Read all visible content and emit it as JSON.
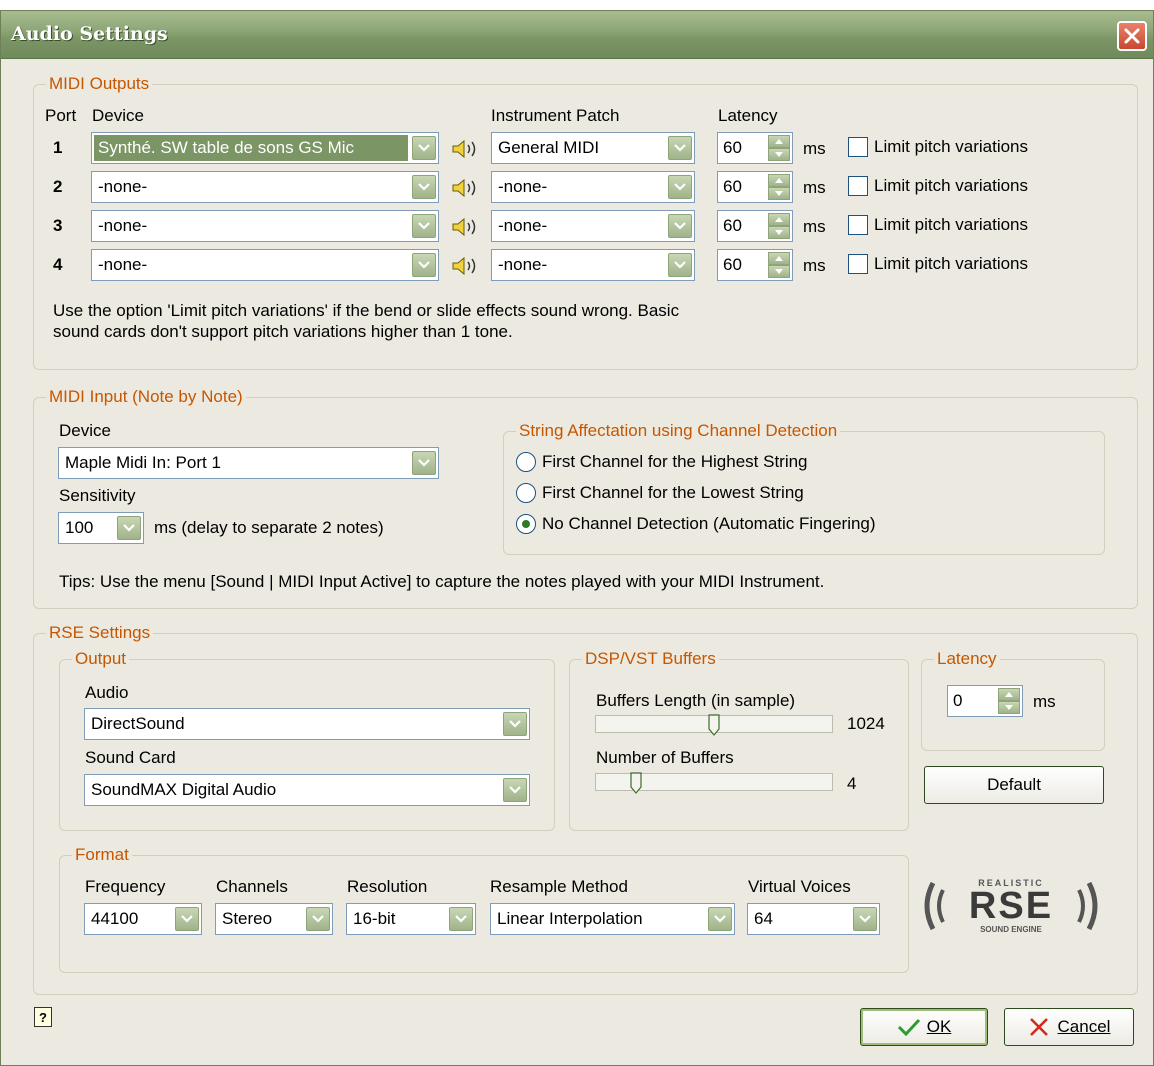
{
  "window": {
    "title": "Audio Settings"
  },
  "midi_outputs": {
    "legend": "MIDI Outputs",
    "headers": {
      "port": "Port",
      "device": "Device",
      "patch": "Instrument Patch",
      "latency": "Latency"
    },
    "rows": [
      {
        "port": "1",
        "device": "Synthé. SW table de sons GS Mic",
        "patch": "General MIDI",
        "latency": "60",
        "unit": "ms",
        "limit": "Limit pitch variations",
        "limit_checked": false
      },
      {
        "port": "2",
        "device": "-none-",
        "patch": "-none-",
        "latency": "60",
        "unit": "ms",
        "limit": "Limit pitch variations",
        "limit_checked": false
      },
      {
        "port": "3",
        "device": "-none-",
        "patch": "-none-",
        "latency": "60",
        "unit": "ms",
        "limit": "Limit pitch variations",
        "limit_checked": false
      },
      {
        "port": "4",
        "device": "-none-",
        "patch": "-none-",
        "latency": "60",
        "unit": "ms",
        "limit": "Limit pitch variations",
        "limit_checked": false
      }
    ],
    "note_line1": "Use the option 'Limit pitch variations' if the bend or slide effects sound wrong. Basic",
    "note_line2": "sound cards don't support pitch variations higher than 1 tone."
  },
  "midi_input": {
    "legend": "MIDI Input (Note by Note)",
    "device_label": "Device",
    "device": "Maple Midi In: Port 1",
    "sensitivity_label": "Sensitivity",
    "sensitivity": "100",
    "sensitivity_note": "ms  (delay to separate 2 notes)",
    "string_group": {
      "legend": "String Affectation using Channel Detection",
      "options": [
        {
          "label": "First Channel for the Highest String",
          "selected": false
        },
        {
          "label": "First Channel for the Lowest String",
          "selected": false
        },
        {
          "label": "No Channel Detection (Automatic Fingering)",
          "selected": true
        }
      ]
    },
    "tips": "Tips: Use the menu [Sound | MIDI Input Active] to capture the notes played with your MIDI Instrument."
  },
  "rse": {
    "legend": "RSE Settings",
    "output": {
      "legend": "Output",
      "audio_label": "Audio",
      "audio": "DirectSound",
      "card_label": "Sound Card",
      "card": "SoundMAX Digital Audio"
    },
    "dsp": {
      "legend": "DSP/VST Buffers",
      "length_label": "Buffers Length (in sample)",
      "length_value": "1024",
      "length_fraction": 0.5,
      "number_label": "Number of Buffers",
      "number_value": "4",
      "number_fraction": 0.15
    },
    "latency": {
      "legend": "Latency",
      "value": "0",
      "unit": "ms"
    },
    "default_button": "Default",
    "format": {
      "legend": "Format",
      "frequency_label": "Frequency",
      "frequency": "44100",
      "channels_label": "Channels",
      "channels": "Stereo",
      "resolution_label": "Resolution",
      "resolution": "16-bit",
      "resample_label": "Resample Method",
      "resample": "Linear Interpolation",
      "voices_label": "Virtual Voices",
      "voices": "64"
    },
    "logo": {
      "top": "REALISTIC",
      "main": "RSE",
      "bottom": "SOUND ENGINE"
    }
  },
  "footer": {
    "help_icon": "?",
    "ok_label": "OK",
    "cancel_label": "Cancel"
  },
  "colors": {
    "accent": "#7b9565",
    "legend_text": "#c65600",
    "close": "#c8482f"
  },
  "icons": [
    "close-icon",
    "speaker-icon",
    "chevron-down-icon",
    "spin-up-icon",
    "spin-down-icon",
    "help-icon",
    "check-icon",
    "cancel-x-icon"
  ]
}
